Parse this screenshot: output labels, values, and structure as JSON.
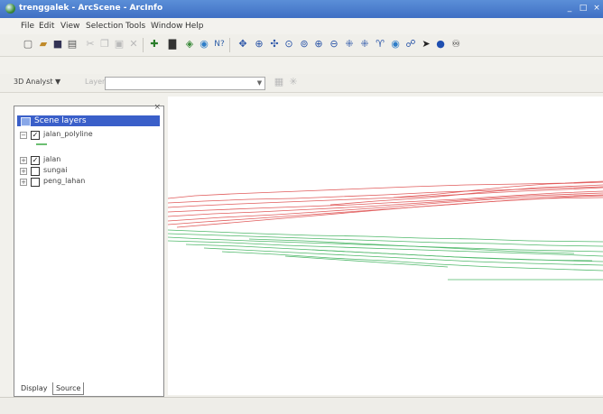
{
  "window": {
    "title": "trenggalek - ArcScene - ArcInfo",
    "controls": {
      "minimize": "_",
      "maximize": "□",
      "close": "×"
    }
  },
  "menubar": {
    "items": [
      "File",
      "Edit",
      "View",
      "Selection",
      "Tools",
      "Window",
      "Help"
    ]
  },
  "toolbar_3d": {
    "dropdown_label": "3D Analyst ▼",
    "layer_label": "Layer:",
    "layer_value": ""
  },
  "table_of_contents": {
    "header": "Scene layers",
    "layers": [
      {
        "name": "jalan_polyline",
        "checked": true
      },
      {
        "name": "jalan",
        "checked": true
      },
      {
        "name": "sungai",
        "checked": false
      },
      {
        "name": "peng_lahan",
        "checked": false
      }
    ],
    "tabs": [
      "Display",
      "Source"
    ]
  },
  "colors": {
    "roads_red": "#e05b5b",
    "roads_green": "#4fb86a",
    "title_blue": "#3f6fc4",
    "toc_header": "#3a5fc9"
  },
  "icons": {
    "standard": [
      "new-document-icon",
      "open-folder-icon",
      "save-icon",
      "print-icon",
      "cut-icon",
      "copy-icon",
      "paste-icon",
      "delete-icon",
      "add-data-icon",
      "scene-properties-icon",
      "animation-icon",
      "globe-icon",
      "help-icon"
    ],
    "navigation": [
      "navigate-icon",
      "zoom-in-out-icon",
      "pan-icon",
      "target-icon",
      "zoom-to-target-icon",
      "zoom-in-icon",
      "zoom-out-icon",
      "full-extent-icon",
      "narrow-fov-icon",
      "fly-icon",
      "center-target-icon",
      "select-graphics-icon",
      "identify-icon",
      "find-icon"
    ]
  }
}
